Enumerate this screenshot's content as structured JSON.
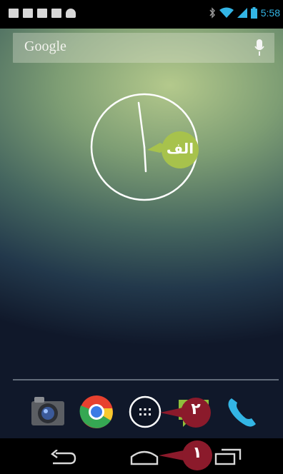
{
  "status_bar": {
    "notification_icons": [
      "facebook-icon",
      "gmail-icon",
      "talk-icon",
      "store-icon",
      "android-icon"
    ],
    "system_icons": [
      "bluetooth-icon",
      "wifi-icon",
      "signal-icon",
      "battery-icon"
    ],
    "time": "5:58",
    "accent_color": "#33b5e5"
  },
  "search_widget": {
    "label": "Google",
    "mic_icon": "microphone-icon"
  },
  "clock_widget": {
    "type": "analog-clock",
    "callout_label": "الف"
  },
  "dock": {
    "apps": [
      {
        "name": "camera-app-icon"
      },
      {
        "name": "chrome-app-icon"
      },
      {
        "name": "all-apps-button"
      },
      {
        "name": "messaging-app-icon"
      },
      {
        "name": "phone-app-icon"
      }
    ],
    "callout_label": "۲"
  },
  "nav_bar": {
    "buttons": [
      "back-button",
      "home-button",
      "recent-apps-button"
    ],
    "callout_label": "۱"
  }
}
